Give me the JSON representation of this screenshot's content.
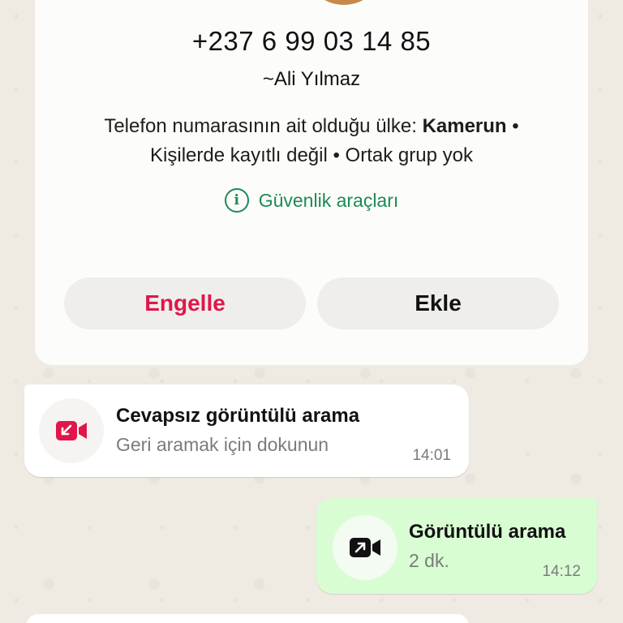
{
  "contact": {
    "phone": "+237 6 99 03 14 85",
    "alias": "~Ali Yılmaz",
    "country_prefix": "Telefon numarasının ait olduğu ülke: ",
    "country": "Kamerun",
    "line2": "Kişilerde kayıtlı değil • Ortak grup yok",
    "security_tools": "Güvenlik araçları",
    "block_button": "Engelle",
    "add_button": "Ekle"
  },
  "messages": [
    {
      "direction": "incoming",
      "title": "Cevapsız görüntülü arama",
      "subtitle": "Geri aramak için dokunun",
      "time": "14:01",
      "icon": "missed-video-call-icon",
      "icon_color": "#e0164a"
    },
    {
      "direction": "outgoing",
      "title": "Görüntülü arama",
      "subtitle": "2 dk.",
      "time": "14:12",
      "icon": "outgoing-video-call-icon",
      "icon_color": "#111111"
    }
  ],
  "colors": {
    "accent_green": "#1d8a57",
    "block_red": "#e0164a",
    "outgoing_bubble": "#d9fdd3",
    "wallpaper": "#efeae2"
  }
}
